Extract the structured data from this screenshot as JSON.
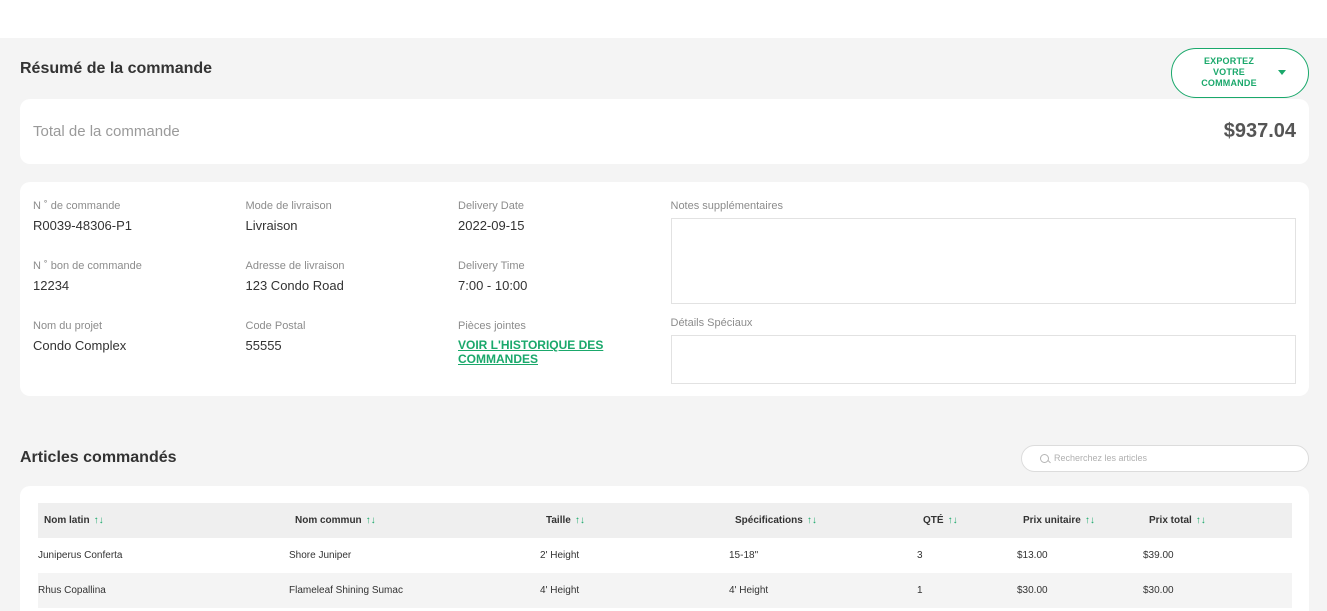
{
  "summary": {
    "title": "Résumé de la commande",
    "export_label": "EXPORTEZ VOTRE COMMANDE"
  },
  "total": {
    "label": "Total de la commande",
    "value": "$937.04"
  },
  "details": {
    "col1": [
      {
        "label": "N ˚ de commande",
        "value": "R0039-48306-P1"
      },
      {
        "label": "N ˚ bon de commande",
        "value": "12234"
      },
      {
        "label": "Nom du projet",
        "value": "Condo Complex"
      }
    ],
    "col2": [
      {
        "label": "Mode de livraison",
        "value": "Livraison"
      },
      {
        "label": "Adresse de livraison",
        "value": "123 Condo Road"
      },
      {
        "label": "Code Postal",
        "value": "55555"
      }
    ],
    "col3": [
      {
        "label": "Delivery Date",
        "value": "2022-09-15"
      },
      {
        "label": "Delivery Time",
        "value": "7:00 - 10:00"
      },
      {
        "label": "Pièces jointes",
        "link": "VOIR L'HISTORIQUE DES COMMANDES"
      }
    ],
    "notes_label": "Notes supplémentaires",
    "special_label": "Détails Spéciaux"
  },
  "articles": {
    "title": "Articles commandés",
    "search_placeholder": "Recherchez les articles",
    "columns": [
      "Nom latin",
      "Nom commun",
      "Taille",
      "Spécifications",
      "QTÉ",
      "Prix unitaire",
      "Prix total"
    ],
    "sort_glyph": "↑↓",
    "rows": [
      [
        "Juniperus Conferta",
        "Shore Juniper",
        "2' Height",
        "15-18\"",
        "3",
        "$13.00",
        "$39.00"
      ],
      [
        "Rhus Copallina",
        "Flameleaf Shining Sumac",
        "4' Height",
        "4' Height",
        "1",
        "$30.00",
        "$30.00"
      ]
    ]
  },
  "colors": {
    "accent": "#1aa86b",
    "background": "#f4f4f4"
  }
}
